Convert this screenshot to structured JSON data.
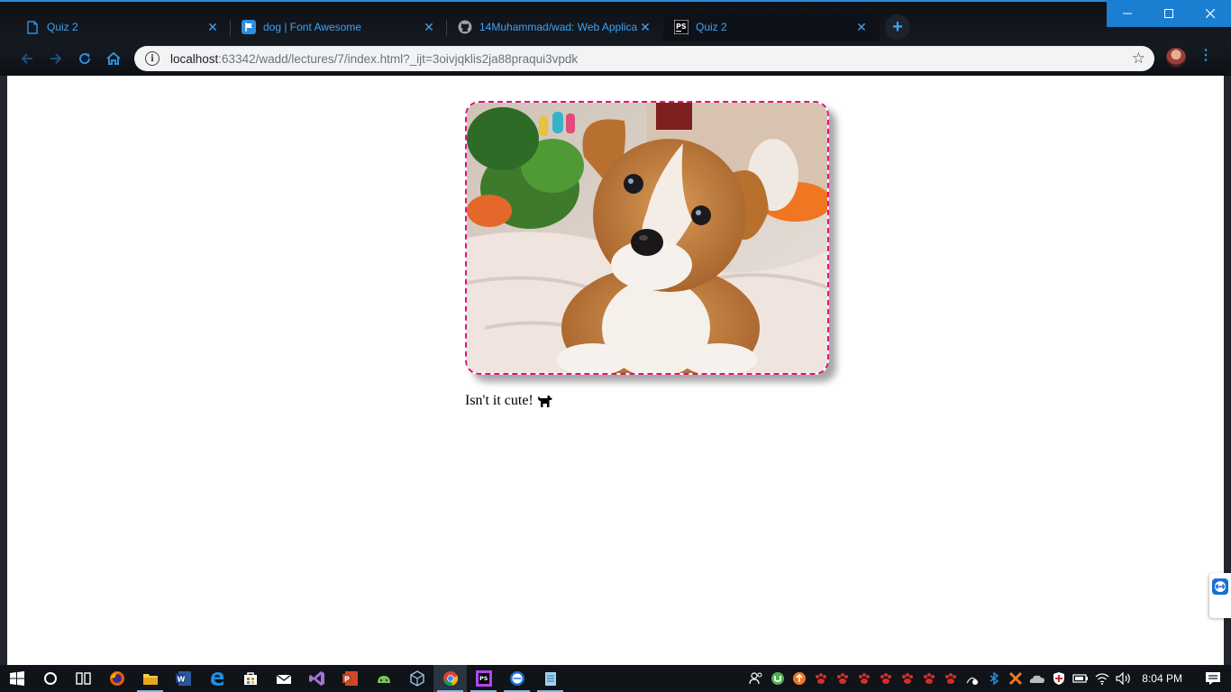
{
  "browser": {
    "tabs": [
      {
        "title": "Quiz 2",
        "favicon": "document-icon",
        "active": false
      },
      {
        "title": "dog | Font Awesome",
        "favicon": "flag-icon",
        "active": false
      },
      {
        "title": "14Muhammad/wad: Web Applica",
        "favicon": "github-icon",
        "active": false
      },
      {
        "title": "Quiz 2",
        "favicon": "phpstorm-icon",
        "active": true
      }
    ],
    "new_tab_label": "+",
    "address": {
      "host": "localhost",
      "rest": ":63342/wadd/lectures/7/index.html?_ijt=3oivjqklis2ja88praqui3vpdk"
    }
  },
  "page": {
    "caption": "Isn't it cute!",
    "caption_icon": "dog-icon",
    "image_subject": "puppy-photo",
    "frame_color": "#e0127c"
  },
  "taskbar": {
    "apps": [
      "start-icon",
      "cortana-icon",
      "task-view-icon",
      "firefox-icon",
      "file-explorer-icon",
      "word-icon",
      "edge-icon",
      "store-icon",
      "mail-icon",
      "visual-studio-icon",
      "powerpoint-icon",
      "android-studio-icon",
      "virtualbox-icon",
      "chrome-icon",
      "phpstorm-icon",
      "teamviewer-icon",
      "notepad-icon"
    ],
    "clock": "8:04 PM"
  },
  "colors": {
    "accent": "#3fa2f2",
    "titlebar_button": "#1a7fd1"
  }
}
